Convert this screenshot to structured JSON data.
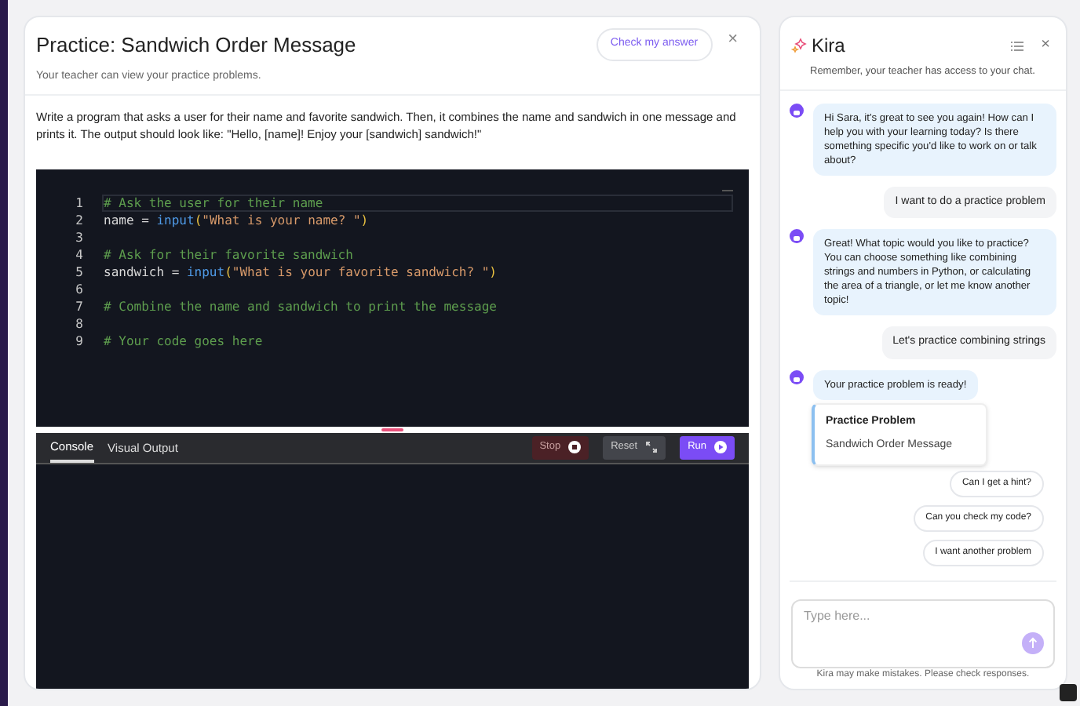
{
  "practice": {
    "title": "Practice: Sandwich Order Message",
    "subtitle": "Your teacher can view your practice problems.",
    "check_button": "Check my answer",
    "close": "×",
    "prompt": "Write a program that asks a user for their name and favorite sandwich. Then, it combines the name and sandwich in one message and prints it. The output should look like: \"Hello, [name]! Enjoy your [sandwich] sandwich!\""
  },
  "editor": {
    "lines": [
      {
        "number": "1",
        "tokens": [
          {
            "kind": "comment",
            "text": "# Ask the user for their name"
          }
        ]
      },
      {
        "number": "2",
        "tokens": [
          {
            "kind": "plain",
            "text": "name = "
          },
          {
            "kind": "func",
            "text": "input"
          },
          {
            "kind": "paren",
            "text": "("
          },
          {
            "kind": "string",
            "text": "\"What is your name? \""
          },
          {
            "kind": "paren",
            "text": ")"
          }
        ]
      },
      {
        "number": "3"
      },
      {
        "number": "4",
        "tokens": [
          {
            "kind": "comment",
            "text": "# Ask for their favorite sandwich"
          }
        ]
      },
      {
        "number": "5",
        "tokens": [
          {
            "kind": "plain",
            "text": "sandwich = "
          },
          {
            "kind": "func",
            "text": "input"
          },
          {
            "kind": "paren",
            "text": "("
          },
          {
            "kind": "string",
            "text": "\"What is your favorite sandwich? \""
          },
          {
            "kind": "paren",
            "text": ")"
          }
        ]
      },
      {
        "number": "6"
      },
      {
        "number": "7",
        "tokens": [
          {
            "kind": "comment",
            "text": "# Combine the name and sandwich to print the message"
          }
        ]
      },
      {
        "number": "8"
      },
      {
        "number": "9",
        "tokens": [
          {
            "kind": "comment",
            "text": "# Your code goes here"
          }
        ]
      }
    ]
  },
  "output_tabs": [
    {
      "label": "Console",
      "selected": true
    },
    {
      "label": "Visual Output",
      "selected": false
    }
  ],
  "run_buttons": [
    {
      "kind": "stop",
      "label": "Stop"
    },
    {
      "kind": "reset",
      "label": "Reset"
    },
    {
      "kind": "run",
      "label": "Run"
    }
  ],
  "chat": {
    "title": "Kira",
    "subtitle": "Remember, your teacher has access to your chat.",
    "close": "×",
    "messages": [
      {
        "kind": "bot",
        "text": "Hi Sara, it's great to see you again! How can I help you with your learning today? Is there something specific you'd like to work on or talk about?"
      },
      {
        "kind": "user",
        "text": "I want to do a practice problem"
      },
      {
        "kind": "bot",
        "text": "Great! What topic would you like to practice? You can choose something like combining strings and numbers in Python, or calculating the area of a triangle, or let me know another topic!"
      },
      {
        "kind": "user",
        "text": "Let's practice combining strings"
      },
      {
        "kind": "bot",
        "text": "Your practice problem is ready!"
      },
      {
        "kind": "card",
        "title": "Practice Problem",
        "text": "Sandwich Order Message"
      }
    ],
    "suggestions": [
      "Can I get a hint?",
      "Can you check my code?",
      "I want another problem"
    ],
    "input": {
      "placeholder": "Type here..."
    },
    "disclaimer": "Kira may make mistakes. Please check responses."
  }
}
